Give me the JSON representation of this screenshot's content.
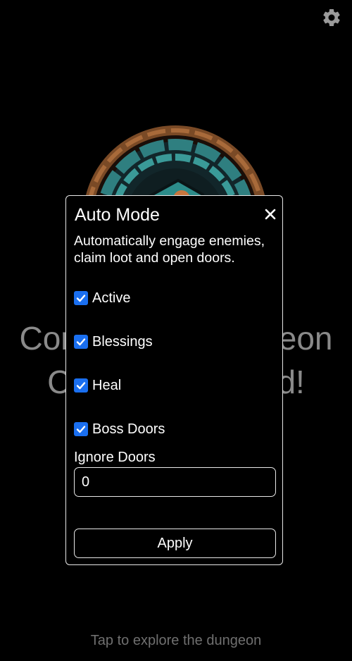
{
  "header": {
    "settings_icon": "gear-icon"
  },
  "background": {
    "headline_line1": "Conquer the dungeon",
    "headline_line2": "Craft your legend!",
    "emblem_icon": "stone-ring-portal-emblem",
    "tap_hint": "Tap to explore the dungeon"
  },
  "dialog": {
    "title": "Auto Mode",
    "close_icon": "close-icon",
    "description": "Automatically engage enemies, claim loot and open doors.",
    "options": [
      {
        "label": "Active",
        "checked": true
      },
      {
        "label": "Blessings",
        "checked": true
      },
      {
        "label": "Heal",
        "checked": true
      },
      {
        "label": "Boss Doors",
        "checked": true
      }
    ],
    "ignore_doors": {
      "label": "Ignore Doors",
      "value": "0"
    },
    "apply_label": "Apply"
  },
  "colors": {
    "checkbox_accent": "#1a6ff0",
    "background": "#000000",
    "dialog_border": "#e8e8e8",
    "muted_text": "#8a8a8a"
  }
}
